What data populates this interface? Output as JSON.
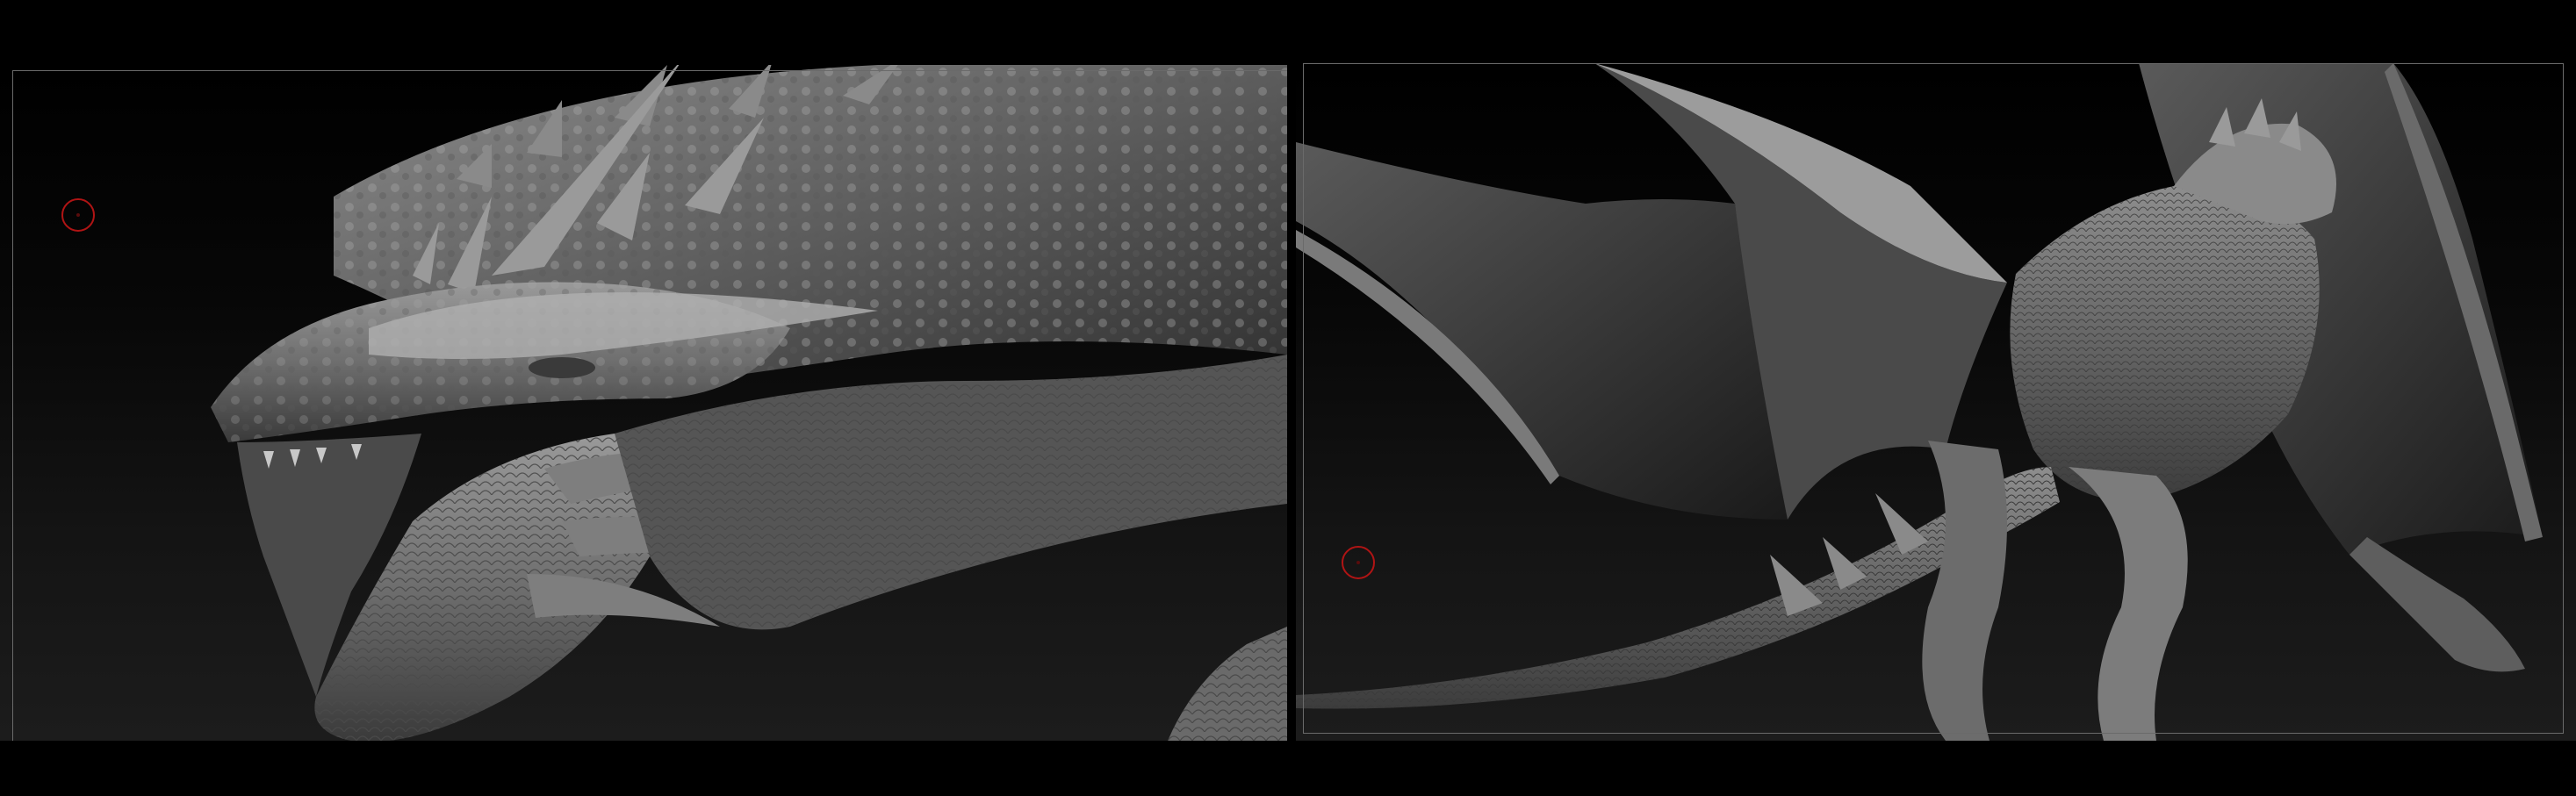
{
  "app": {
    "background_color": "#000000",
    "frame_color": "#6a6a6a",
    "pivot_color": "#b01414"
  },
  "viewports": [
    {
      "name": "head-closeup-view",
      "subject": "dragon-head-sculpt",
      "pivot_icon": "transpose-pivot-icon"
    },
    {
      "name": "full-body-view",
      "subject": "dragon-full-body-sculpt",
      "pivot_icon": "transpose-pivot-icon"
    }
  ]
}
